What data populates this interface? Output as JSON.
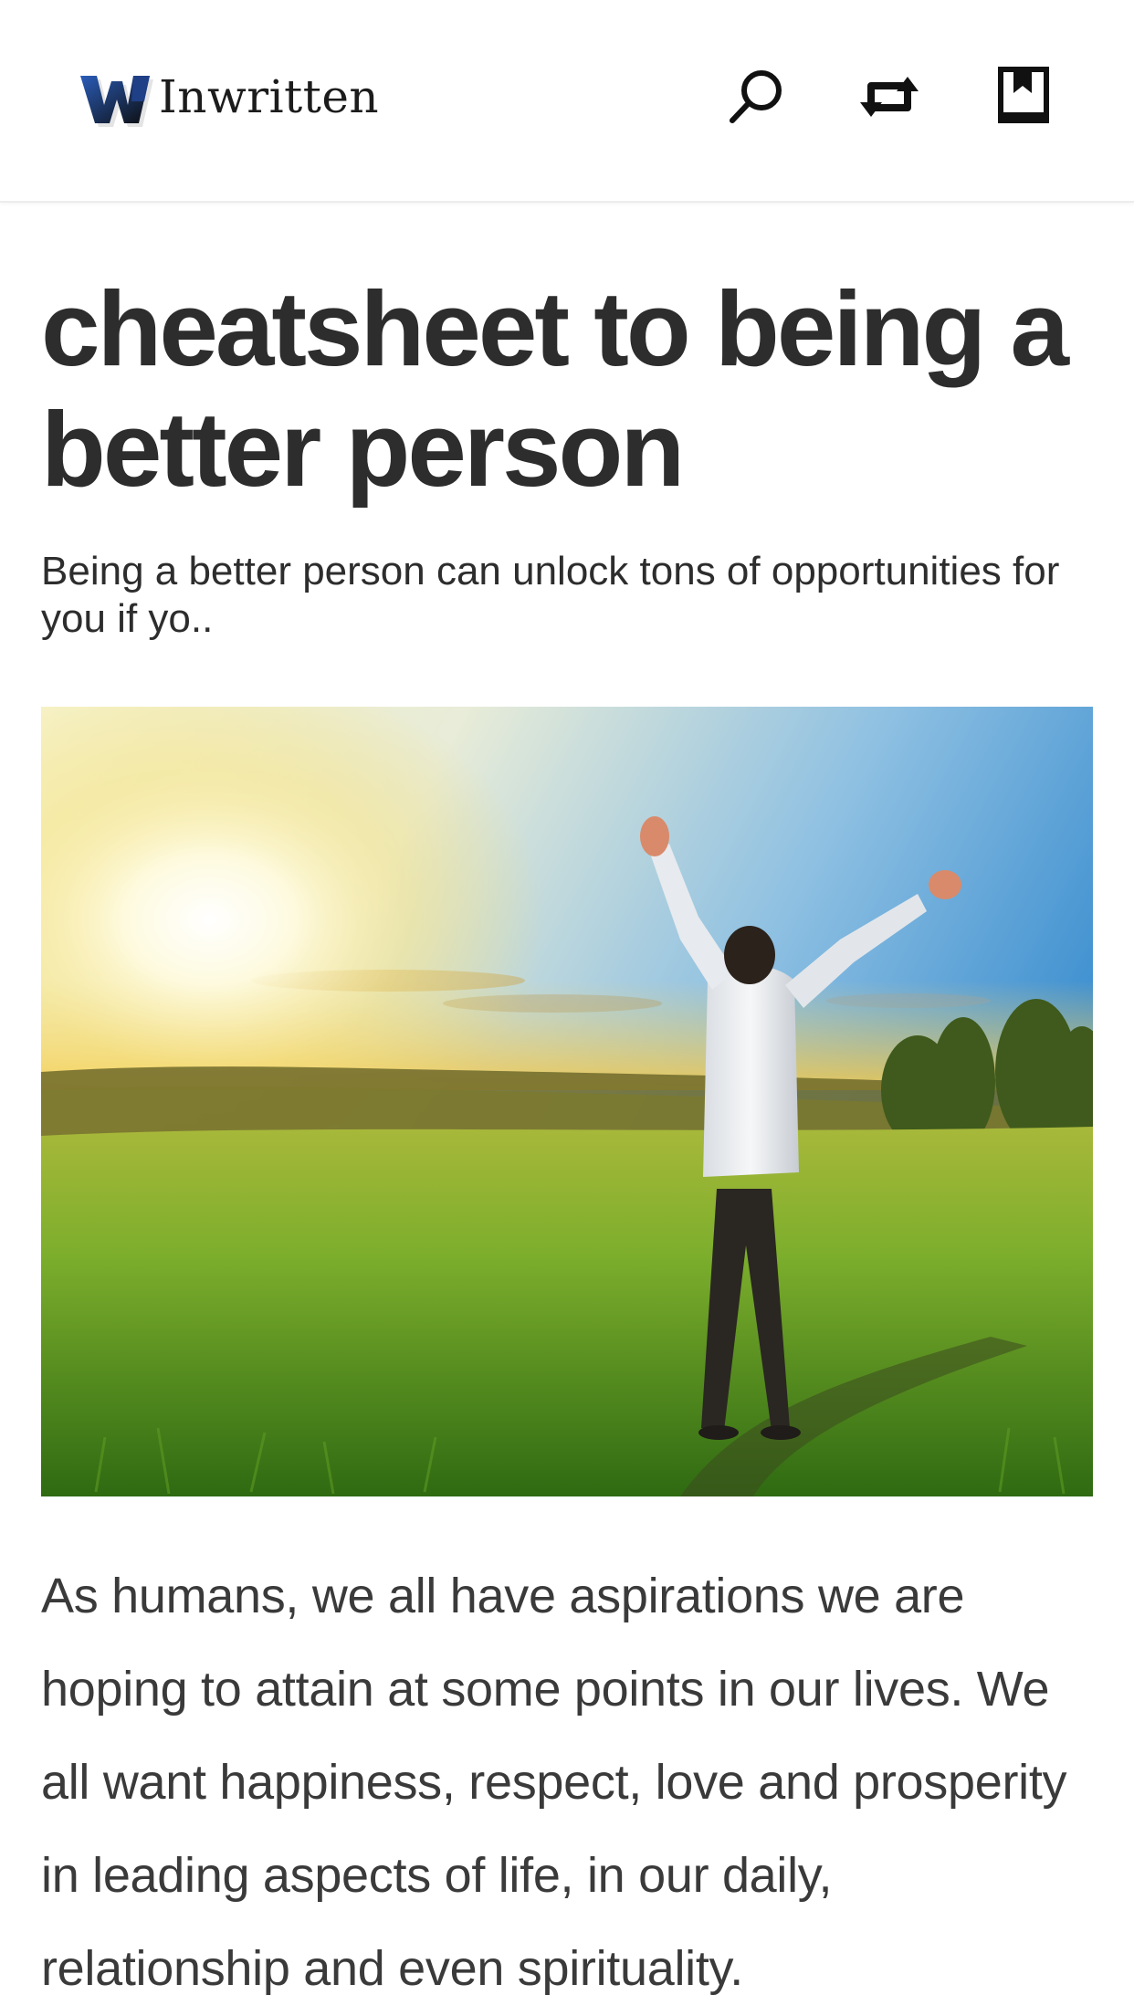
{
  "header": {
    "brand": "Inwritten",
    "icons": {
      "search": "search-icon",
      "refresh": "refresh-icon",
      "bookmark": "bookmark-icon"
    }
  },
  "article": {
    "title": "cheatsheet to being a better person",
    "summary": "Being a better person can unlock tons of opportunities for you if yo..",
    "hero_image_alt": "",
    "body": "As humans, we all have aspirations we are hoping to attain at some points in our lives. We all want happiness, respect, love and prosperity in leading aspects of life, in our daily, relationship and even spirituality."
  },
  "colors": {
    "text": "#2d2d2d",
    "body_text": "#3a3a3a",
    "header_border": "#ececec",
    "logo_dark": "#111111",
    "logo_blue": "#2a5cb8"
  }
}
